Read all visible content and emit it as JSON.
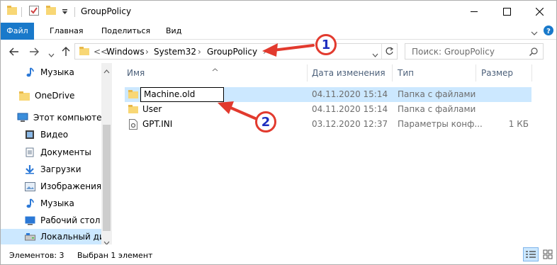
{
  "window": {
    "title": "GroupPolicy"
  },
  "ribbon": {
    "tabs": [
      "Файл",
      "Главная",
      "Поделиться",
      "Вид"
    ]
  },
  "address": {
    "prefix": "<<",
    "crumbs": [
      "Windows",
      "System32",
      "GroupPolicy"
    ]
  },
  "search": {
    "placeholder": "Поиск: GroupPolicy"
  },
  "sidebar": {
    "items": [
      {
        "label": "Музыка",
        "icon": "music-icon"
      },
      {
        "label": "OneDrive",
        "icon": "folder-icon"
      },
      {
        "label": "Этот компьютер",
        "icon": "computer-icon"
      },
      {
        "label": "Видео",
        "icon": "video-icon"
      },
      {
        "label": "Документы",
        "icon": "documents-icon"
      },
      {
        "label": "Загрузки",
        "icon": "download-icon"
      },
      {
        "label": "Изображения",
        "icon": "pictures-icon"
      },
      {
        "label": "Музыка",
        "icon": "music-icon"
      },
      {
        "label": "Рабочий стол",
        "icon": "desktop-icon"
      },
      {
        "label": "Локальный дис",
        "icon": "drive-icon"
      }
    ]
  },
  "columns": [
    "Имя",
    "Дата изменения",
    "Тип",
    "Размер"
  ],
  "files": [
    {
      "name": "Machine.old",
      "date": "04.11.2020 15:14",
      "type": "Папка с файлами",
      "size": "",
      "icon": "folder-icon"
    },
    {
      "name": "User",
      "date": "04.11.2020 15:14",
      "type": "Папка с файлами",
      "size": "",
      "icon": "folder-icon"
    },
    {
      "name": "GPT.INI",
      "date": "03.12.2020 12:37",
      "type": "Параметры конф...",
      "size": "1 КБ",
      "icon": "settings-file-icon"
    }
  ],
  "status": {
    "count": "Элементов: 3",
    "selected": "Выбран 1 элемент"
  },
  "annotations": [
    "1",
    "2"
  ],
  "colors": {
    "accent": "#1979ca",
    "selection": "#cce8ff",
    "annotation": "#e23a2e",
    "annotation_text": "#1f2fbf"
  }
}
